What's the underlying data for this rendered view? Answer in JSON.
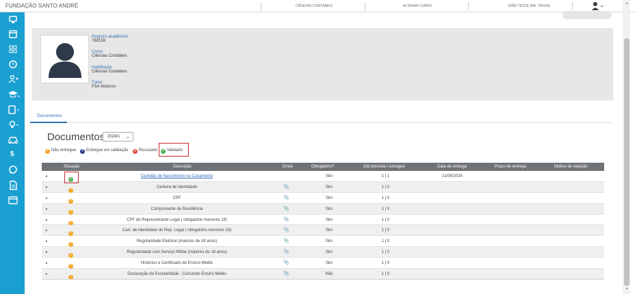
{
  "topbar": {
    "brand": "FUNDAÇÃO SANTO ANDRÉ",
    "course": "CIÊNCIAS CONTÁBEIS",
    "change_course": "ALTERAR CURSO",
    "user": "JOÃO TESTE (RA: 760159)"
  },
  "sidebar": {
    "items": [
      "monitor-icon",
      "calendar-icon",
      "grid-icon",
      "clock-icon",
      "user-add-icon",
      "graduation-cap-icon",
      "clipboard-icon",
      "lightbulb-icon",
      "car-icon",
      "dollar-icon",
      "chat-icon",
      "document-icon",
      "id-card-icon"
    ]
  },
  "profile": {
    "ra_label": "Registro acadêmico",
    "ra_value": "760159",
    "curso_label": "Curso",
    "curso_value": "Ciências Contábeis",
    "habilitacao_label": "Habilitação",
    "habilitacao_value": "Ciências Contábeis",
    "turno_label": "Turno",
    "turno_value": "FSA-Noturno"
  },
  "tabs": {
    "documentos": "Documentos"
  },
  "documents": {
    "title": "Documentos:",
    "year_selected": "2024/1"
  },
  "legend": {
    "nao_entregue": "Não entregue",
    "em_validacao": "Entregue em validação",
    "recusado": "Recusado",
    "validado": "Validado"
  },
  "colors": {
    "sidebar": "#1a9fd1",
    "accent": "#2c6fb3",
    "status_pending": "#f5a623",
    "status_validation": "#2a3c8c",
    "status_refused": "#e04b3a",
    "status_valid": "#4cb050",
    "highlight": "#c62828"
  },
  "table": {
    "headers": {
      "situacao": "Situação",
      "descricao": "Descrição",
      "envio": "Envio",
      "obrigatorio": "Obrigatório?",
      "qtd": "Qtd prevista | entregue",
      "data_entrega": "Data de entrega",
      "prazo": "Prazo de entrega",
      "motivo": "Motivo de rejeição"
    },
    "rows": [
      {
        "status": "validado",
        "descricao": "Certidão de Nascimento ou Casamento",
        "obrigatorio": "Sim",
        "qtd": "1 | 1",
        "data": "21/05/2024"
      },
      {
        "status": "nao_entregue",
        "descricao": "Carteira de Identidade",
        "obrigatorio": "Sim",
        "qtd": "1 | 0",
        "data": ""
      },
      {
        "status": "nao_entregue",
        "descricao": "CPF",
        "obrigatorio": "Sim",
        "qtd": "1 | 0",
        "data": ""
      },
      {
        "status": "nao_entregue",
        "descricao": "Comprovante de Residência",
        "obrigatorio": "Sim",
        "qtd": "1 | 0",
        "data": ""
      },
      {
        "status": "nao_entregue",
        "descricao": "CPF do Representante Legal ( obrigatório menores 18)",
        "obrigatorio": "Sim",
        "qtd": "1 | 0",
        "data": ""
      },
      {
        "status": "nao_entregue",
        "descricao": "Cart. de Identidade do Rep. Legal ( obrigatório menores 18)",
        "obrigatorio": "Sim",
        "qtd": "1 | 0",
        "data": ""
      },
      {
        "status": "nao_entregue",
        "descricao": "Regularidade Eleitoral (maiores de 18 anos)",
        "obrigatorio": "Sim",
        "qtd": "1 | 0",
        "data": ""
      },
      {
        "status": "nao_entregue",
        "descricao": "Regularidade com Serviço Militar (maiores de 18 anos)",
        "obrigatorio": "Sim",
        "qtd": "1 | 0",
        "data": ""
      },
      {
        "status": "nao_entregue",
        "descricao": "Histórico e Certificado do Ensino Médio",
        "obrigatorio": "Sim",
        "qtd": "1 | 0",
        "data": ""
      },
      {
        "status": "nao_entregue",
        "descricao": "Declaração de Escolaridade - Cursando Ensino Médio",
        "obrigatorio": "Não",
        "qtd": "1 | 0",
        "data": ""
      }
    ]
  }
}
